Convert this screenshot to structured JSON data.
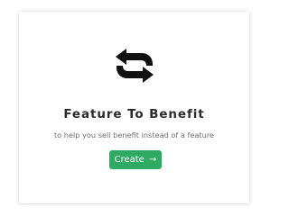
{
  "card": {
    "icon": "exchange-arrows-icon",
    "title": "Feature To Benefit",
    "subtitle": "to help you sell benefit instead of a feature",
    "button": {
      "label": "Create",
      "arrow": "→",
      "color": "#2eaa62"
    }
  },
  "colors": {
    "background": "#ffffff",
    "title": "#2b2b2b",
    "subtitle": "#6e6e6e",
    "icon": "#111111"
  }
}
